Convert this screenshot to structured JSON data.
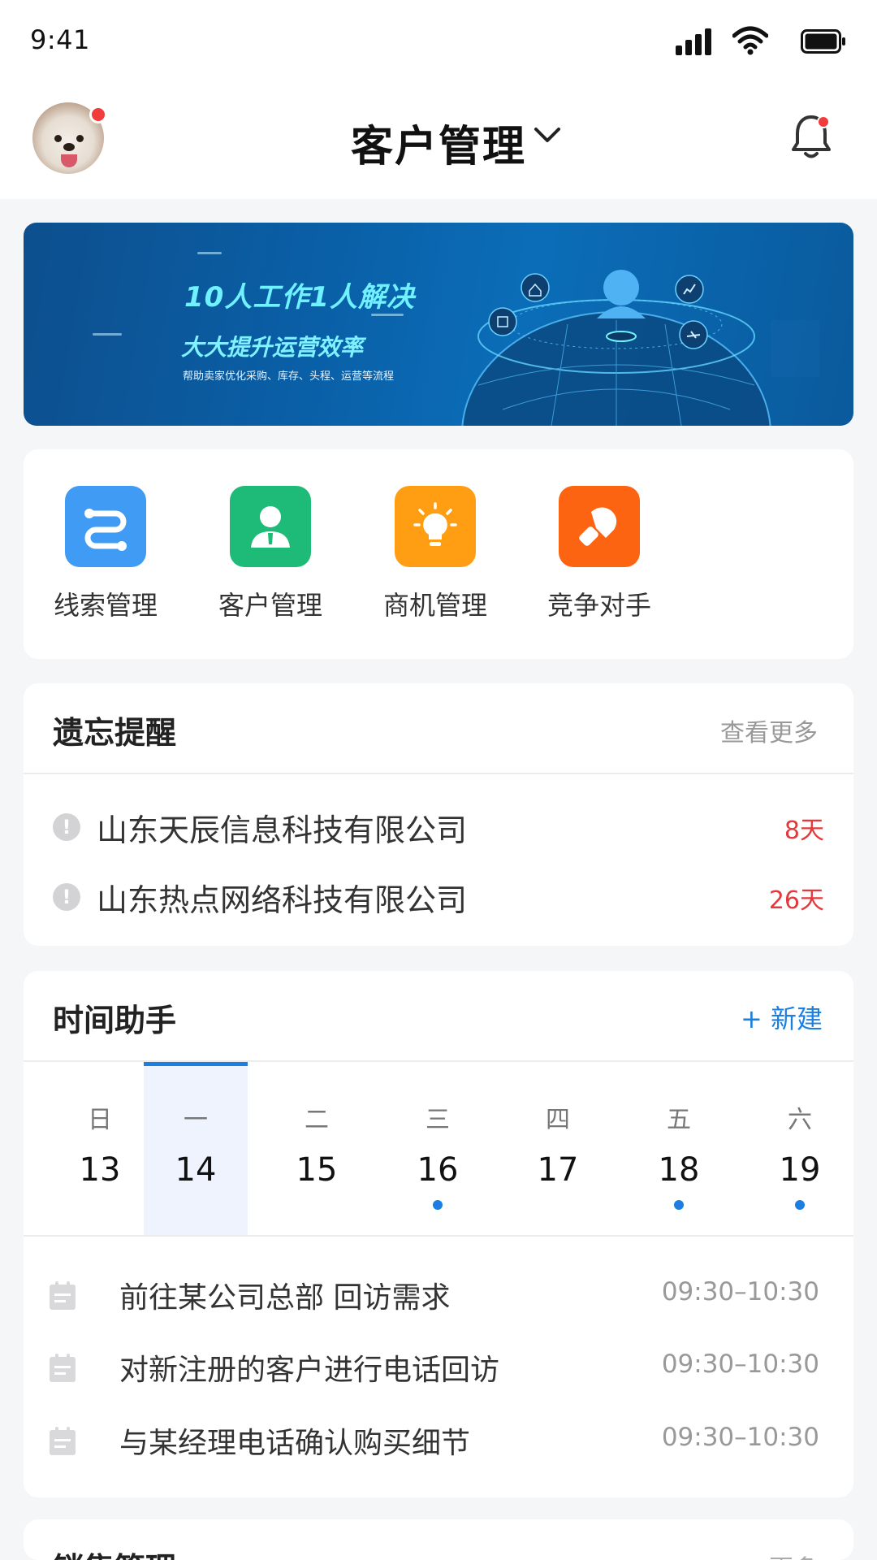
{
  "status_bar": {
    "time": "9:41"
  },
  "header": {
    "title": "客户管理"
  },
  "banner": {
    "headline": "10人工作1人解决",
    "subheadline": "大大提升运营效率",
    "caption": "帮助卖家优化采购、库存、头程、运营等流程"
  },
  "quick_actions": [
    {
      "label": "线索管理",
      "icon": "route-icon",
      "color": "#3f9bf3"
    },
    {
      "label": "客户管理",
      "icon": "person-icon",
      "color": "#1eba78"
    },
    {
      "label": "商机管理",
      "icon": "lightbulb-icon",
      "color": "#ff9e12"
    },
    {
      "label": "竞争对手",
      "icon": "boxing-glove-icon",
      "color": "#fd6412"
    }
  ],
  "memo": {
    "title": "遗忘提醒",
    "more": "查看更多",
    "items": [
      {
        "name": "山东天辰信息科技有限公司",
        "days": "8天"
      },
      {
        "name": "山东热点网络科技有限公司",
        "days": "26天"
      }
    ]
  },
  "time_assistant": {
    "title": "时间助手",
    "new_label": "+ 新建",
    "week": [
      {
        "weekday": "日",
        "day": "13",
        "has_event": false,
        "active": false
      },
      {
        "weekday": "一",
        "day": "14",
        "has_event": false,
        "active": true
      },
      {
        "weekday": "二",
        "day": "15",
        "has_event": false,
        "active": false
      },
      {
        "weekday": "三",
        "day": "16",
        "has_event": true,
        "active": false
      },
      {
        "weekday": "四",
        "day": "17",
        "has_event": false,
        "active": false
      },
      {
        "weekday": "五",
        "day": "18",
        "has_event": true,
        "active": false
      },
      {
        "weekday": "六",
        "day": "19",
        "has_event": true,
        "active": false
      }
    ],
    "tasks": [
      {
        "title": "前往某公司总部 回访需求",
        "time": "09:30–10:30"
      },
      {
        "title": "对新注册的客户进行电话回访",
        "time": "09:30–10:30"
      },
      {
        "title": "与某经理电话确认购买细节",
        "time": "09:30–10:30"
      }
    ]
  },
  "sales": {
    "title": "销售管理",
    "more": "更多"
  },
  "colors": {
    "accent": "#1a7fe0",
    "alert": "#e4393c",
    "badge": "#f23b3b"
  }
}
